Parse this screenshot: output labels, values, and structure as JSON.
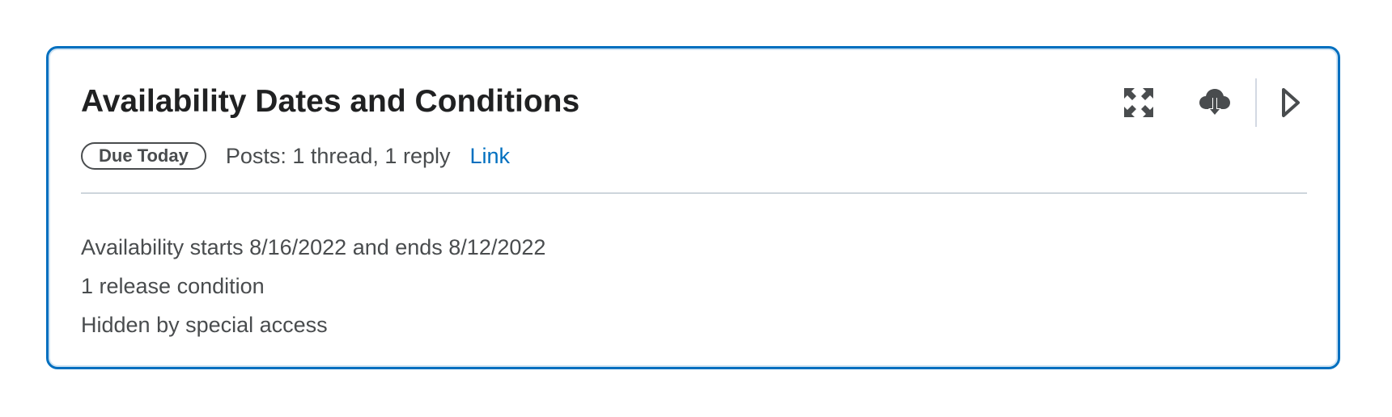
{
  "card": {
    "title": "Availability Dates and Conditions",
    "badge": "Due Today",
    "posts": "Posts: 1 thread, 1 reply",
    "link": "Link",
    "details": [
      "Availability starts 8/16/2022 and ends 8/12/2022",
      "1 release condition",
      "Hidden by special access"
    ],
    "actions": {
      "expand_icon": "expand-arrows-icon",
      "upload_icon": "cloud-upload-icon",
      "arrow_icon": "play-triangle-icon"
    }
  },
  "colors": {
    "accent": "#006fbf",
    "text": "#202122",
    "secondary_text": "#494c4e",
    "divider": "#cdd5dc"
  }
}
